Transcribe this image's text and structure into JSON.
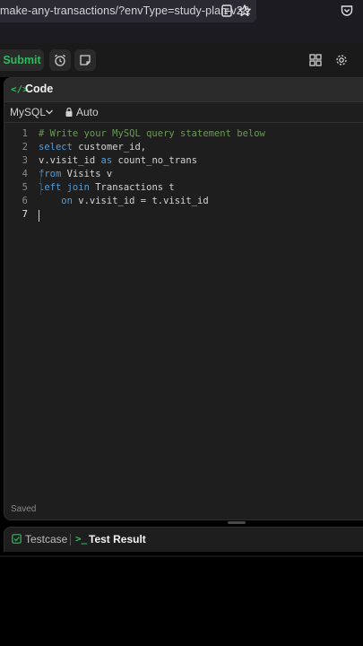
{
  "browser": {
    "url": "make-any-transactions/?envType=study-plan-v2&",
    "icons": [
      "reader-mode-icon",
      "bookmark-star-icon",
      "pocket-icon"
    ]
  },
  "toolbar": {
    "submit_label": "Submit",
    "icons": [
      "alarm-clock-icon",
      "note-icon",
      "layout-icon",
      "gear-icon"
    ]
  },
  "editor_panel": {
    "title": "Code",
    "language": "MySQL",
    "autocomplete": "Auto",
    "status": "Saved",
    "line_numbers": [
      "1",
      "2",
      "3",
      "4",
      "5",
      "6",
      "7"
    ],
    "lines": [
      [
        {
          "t": "cm",
          "v": "# Write your MySQL query statement below"
        }
      ],
      [
        {
          "t": "kw",
          "v": "select"
        },
        {
          "t": "tx",
          "v": " customer_id,"
        }
      ],
      [
        {
          "t": "tx",
          "v": "v.visit_id "
        },
        {
          "t": "kw",
          "v": "as"
        },
        {
          "t": "tx",
          "v": " count_no_trans"
        }
      ],
      [
        {
          "t": "kw",
          "v": "from"
        },
        {
          "t": "tx",
          "v": " Visits v"
        }
      ],
      [
        {
          "t": "kw",
          "v": "left join"
        },
        {
          "t": "tx",
          "v": " Transactions t"
        }
      ],
      [
        {
          "t": "tx",
          "v": "    "
        },
        {
          "t": "kw",
          "v": "on"
        },
        {
          "t": "tx",
          "v": " v.visit_id = t.visit_id"
        }
      ],
      []
    ]
  },
  "bottom_tabs": {
    "testcase_label": "Testcase",
    "test_result_label": "Test Result"
  },
  "colors": {
    "accent": "#2cbb5d",
    "keyword": "#569cd6",
    "comment": "#6a9955"
  }
}
